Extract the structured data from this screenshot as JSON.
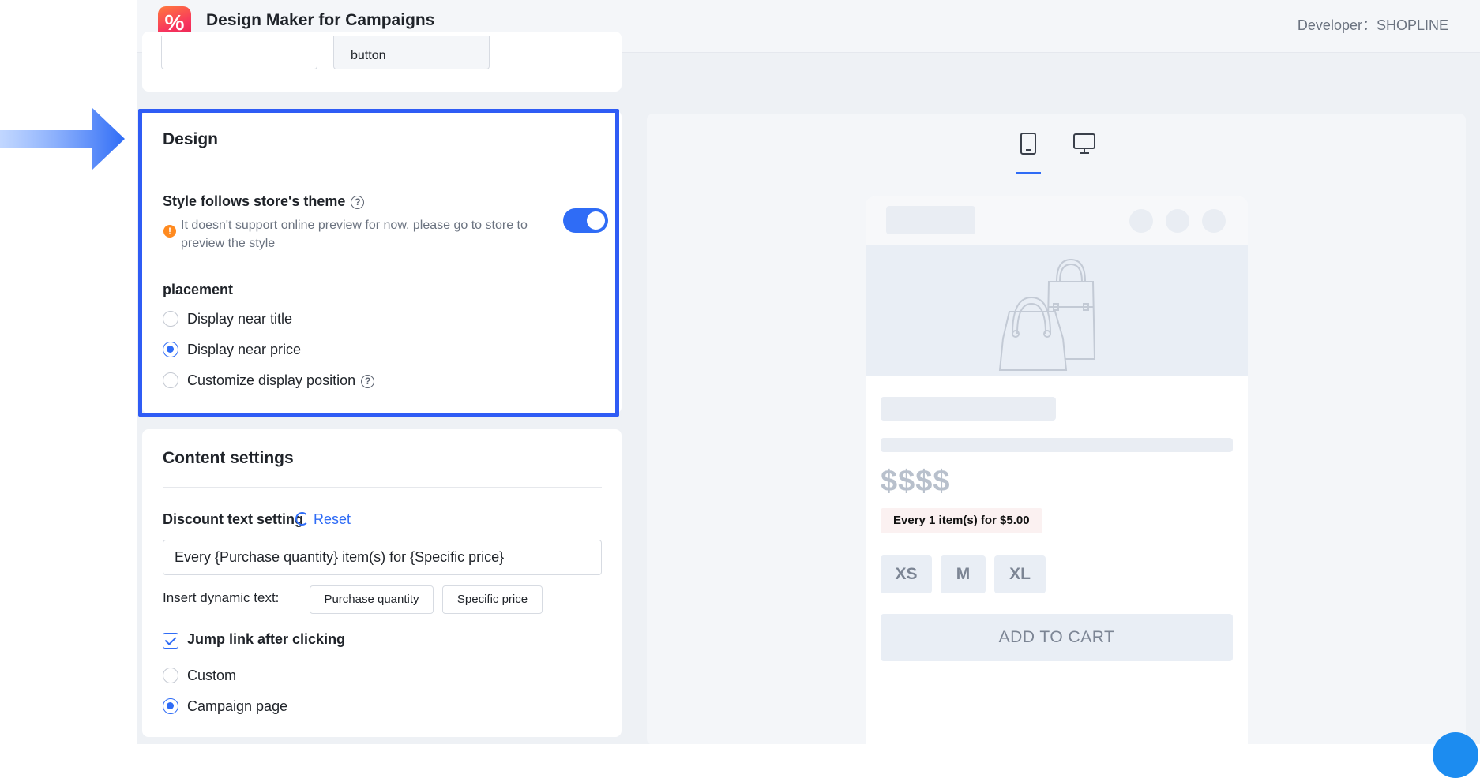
{
  "header": {
    "logo_glyph": "%",
    "title": "Design Maker for Campaigns",
    "developer": "Developer：SHOPLINE"
  },
  "top_card": {
    "button_label": "button"
  },
  "design": {
    "title": "Design",
    "style_label": "Style follows store's theme",
    "style_enabled": true,
    "warning_text": "It doesn't support online preview for now, please go to store to preview the style",
    "placement_label": "placement",
    "placement_options": [
      {
        "label": "Display near title",
        "selected": false
      },
      {
        "label": "Display near price",
        "selected": true
      },
      {
        "label": "Customize display position",
        "selected": false
      }
    ]
  },
  "content": {
    "title": "Content settings",
    "discount_label": "Discount text setting",
    "reset_label": "Reset",
    "discount_value": "Every {Purchase quantity} item(s) for {Specific price}",
    "insert_label": "Insert dynamic text:",
    "chips": [
      "Purchase quantity",
      "Specific price"
    ],
    "jump_label": "Jump link after clicking",
    "jump_checked": true,
    "link_options": [
      {
        "label": "Custom",
        "selected": false
      },
      {
        "label": "Campaign page",
        "selected": true
      }
    ]
  },
  "preview": {
    "tabs": [
      "mobile-icon",
      "desktop-icon"
    ],
    "active_tab": "mobile-icon",
    "price_placeholder": "$$$$",
    "discount_tag": "Every 1 item(s) for $5.00",
    "sizes": [
      "XS",
      "M",
      "XL"
    ],
    "add_to_cart": "ADD TO CART"
  },
  "colors": {
    "accent": "#2f6cf6",
    "highlight_border": "#2f5cf5",
    "warning": "#ff8a1f"
  }
}
